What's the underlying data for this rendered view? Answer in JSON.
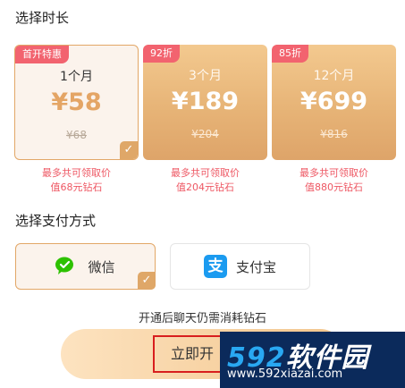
{
  "duration_section": {
    "title": "选择时长"
  },
  "plans": [
    {
      "badge": "首开特惠",
      "duration": "1个月",
      "price": "¥58",
      "original_price": "¥68",
      "note_line1": "最多共可领取价",
      "note_line2": "值68元钻石",
      "selected": true
    },
    {
      "badge": "92折",
      "duration": "3个月",
      "price": "¥189",
      "original_price": "¥204",
      "note_line1": "最多共可领取价",
      "note_line2": "值204元钻石",
      "selected": false
    },
    {
      "badge": "85折",
      "duration": "12个月",
      "price": "¥699",
      "original_price": "¥816",
      "note_line1": "最多共可领取价",
      "note_line2": "值880元钻石",
      "selected": false
    }
  ],
  "payment_section": {
    "title": "选择支付方式",
    "methods": [
      {
        "label": "微信",
        "icon": "wechat-icon",
        "selected": true
      },
      {
        "label": "支付宝",
        "icon": "alipay-icon",
        "selected": false
      }
    ]
  },
  "consume_note": "开通后聊天仍需消耗钻石",
  "open_button": {
    "label": "立即开"
  },
  "watermark": {
    "brand_num": "592",
    "brand_text": "软件园",
    "url": "www.592xiazai.com"
  },
  "check_mark": "✓",
  "alipay_glyph": "支",
  "colors": {
    "accent": "#e4a565",
    "badge": "#f2636f",
    "note": "#ee5763",
    "alipay": "#1b9bf0",
    "wechat": "#2dc100"
  }
}
